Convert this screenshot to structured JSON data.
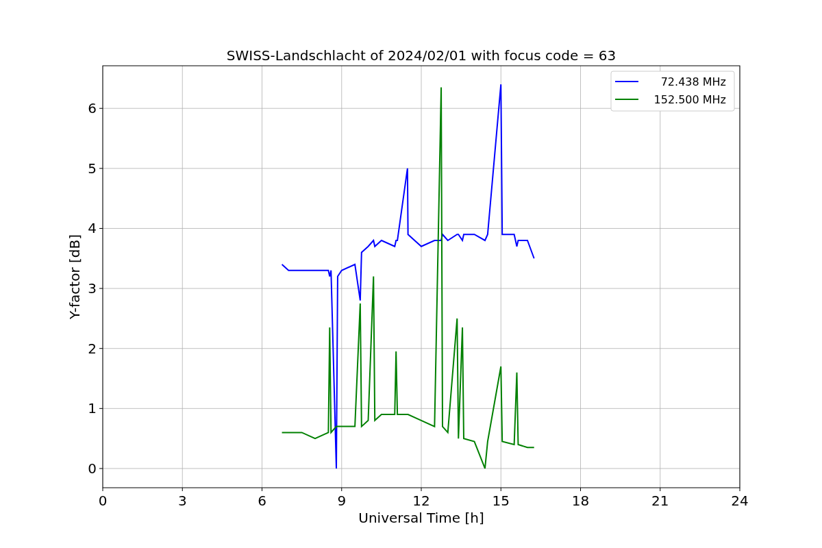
{
  "figure": {
    "chart_data": {
      "type": "line",
      "title": "SWISS-Landschlacht of 2024/02/01 with focus code = 63",
      "xlabel": "Universal Time [h]",
      "ylabel": "Y-factor [dB]",
      "x": [
        6.75,
        7.0,
        7.5,
        8.0,
        8.5,
        8.55,
        8.6,
        8.8,
        8.85,
        9.0,
        9.5,
        9.7,
        9.75,
        10.0,
        10.2,
        10.25,
        10.5,
        11.0,
        11.05,
        11.1,
        11.48,
        11.5,
        12.0,
        12.5,
        12.75,
        12.8,
        13.0,
        13.35,
        13.4,
        13.55,
        13.6,
        14.0,
        14.4,
        14.5,
        15.0,
        15.05,
        15.5,
        15.6,
        15.65,
        16.0,
        16.25
      ],
      "series": [
        {
          "name": "72.438 MHz",
          "color": "#0000ff",
          "values": [
            3.4,
            3.3,
            3.3,
            3.3,
            3.3,
            3.2,
            3.3,
            0.0,
            3.2,
            3.3,
            3.4,
            2.8,
            3.6,
            3.7,
            3.8,
            3.7,
            3.8,
            3.7,
            3.8,
            3.8,
            5.0,
            3.9,
            3.7,
            3.8,
            3.8,
            3.9,
            3.8,
            3.9,
            3.9,
            3.8,
            3.9,
            3.9,
            3.8,
            3.9,
            6.4,
            3.9,
            3.9,
            3.7,
            3.8,
            3.8,
            3.5
          ]
        },
        {
          "name": "152.500 MHz",
          "color": "#008000",
          "values": [
            0.6,
            0.6,
            0.6,
            0.5,
            0.6,
            2.35,
            0.6,
            0.7,
            0.7,
            0.7,
            0.7,
            2.75,
            0.7,
            0.8,
            3.2,
            0.8,
            0.9,
            0.9,
            1.95,
            0.9,
            0.9,
            0.9,
            0.8,
            0.7,
            6.35,
            0.7,
            0.6,
            2.5,
            0.5,
            2.35,
            0.5,
            0.45,
            0.0,
            0.45,
            1.7,
            0.45,
            0.4,
            1.6,
            0.4,
            0.35,
            0.35
          ]
        }
      ],
      "xlim": [
        0,
        24
      ],
      "ylim": [
        -0.32,
        6.71
      ],
      "xticks": [
        0,
        3,
        6,
        9,
        12,
        15,
        18,
        21,
        24
      ],
      "yticks": [
        0,
        1,
        2,
        3,
        4,
        5,
        6
      ],
      "grid": true,
      "legend": "upper right"
    }
  }
}
